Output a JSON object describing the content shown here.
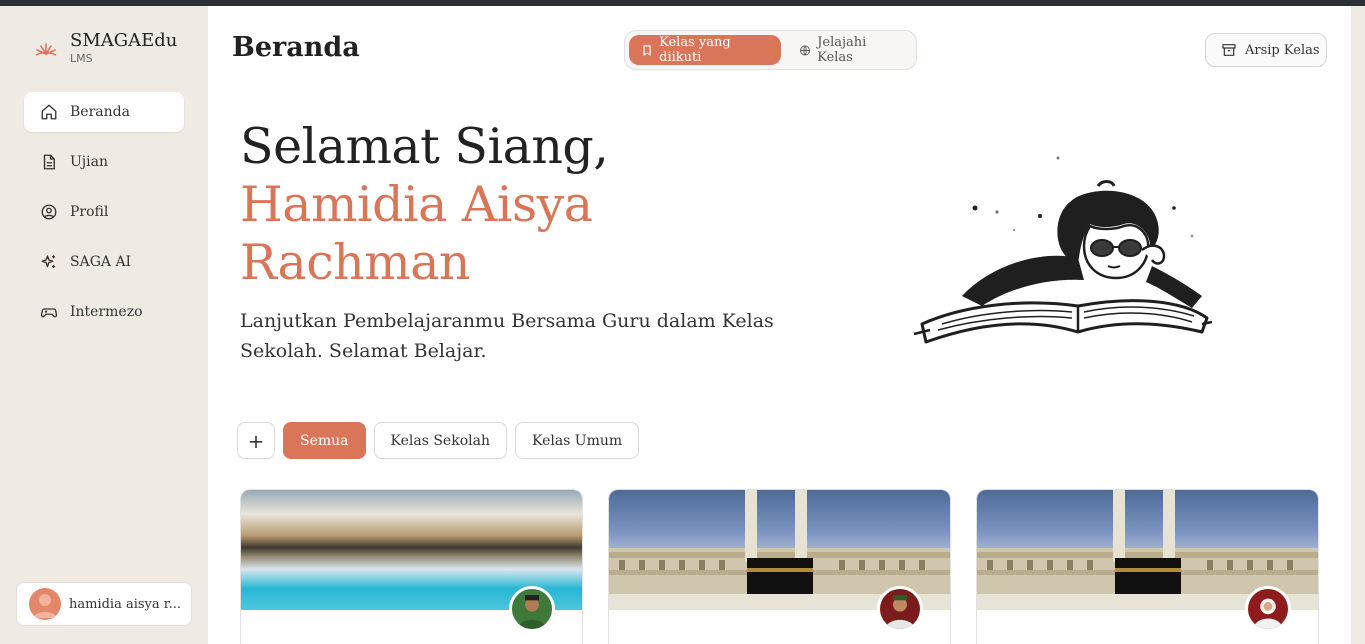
{
  "brand": {
    "name": "SMAGAEdu",
    "sub": "LMS"
  },
  "sidebar": {
    "items": [
      {
        "label": "Beranda",
        "icon": "home-icon",
        "active": true
      },
      {
        "label": "Ujian",
        "icon": "document-icon",
        "active": false
      },
      {
        "label": "Profil",
        "icon": "user-circle-icon",
        "active": false
      },
      {
        "label": "SAGA AI",
        "icon": "sparkles-icon",
        "active": false
      },
      {
        "label": "Intermezo",
        "icon": "gamepad-icon",
        "active": false
      }
    ],
    "user": "hamidia aisya r..."
  },
  "header": {
    "title": "Beranda",
    "tabs": [
      {
        "label": "Kelas yang diikuti",
        "icon": "bookmark-icon",
        "active": true
      },
      {
        "label": "Jelajahi Kelas",
        "icon": "globe-icon",
        "active": false
      }
    ],
    "archive_label": "Arsip Kelas"
  },
  "hero": {
    "greeting": "Selamat Siang,",
    "name_line1": "Hamidia Aisya",
    "name_line2": "Rachman",
    "subtext": "Lanjutkan Pembelajaranmu Bersama Guru dalam Kelas Sekolah. Selamat Belajar."
  },
  "filters": {
    "add_label": "+",
    "items": [
      {
        "label": "Semua",
        "active": true
      },
      {
        "label": "Kelas Sekolah",
        "active": false
      },
      {
        "label": "Kelas Umum",
        "active": false
      }
    ]
  },
  "colors": {
    "accent": "#d9765a",
    "sidebar_bg": "#efebe4"
  }
}
